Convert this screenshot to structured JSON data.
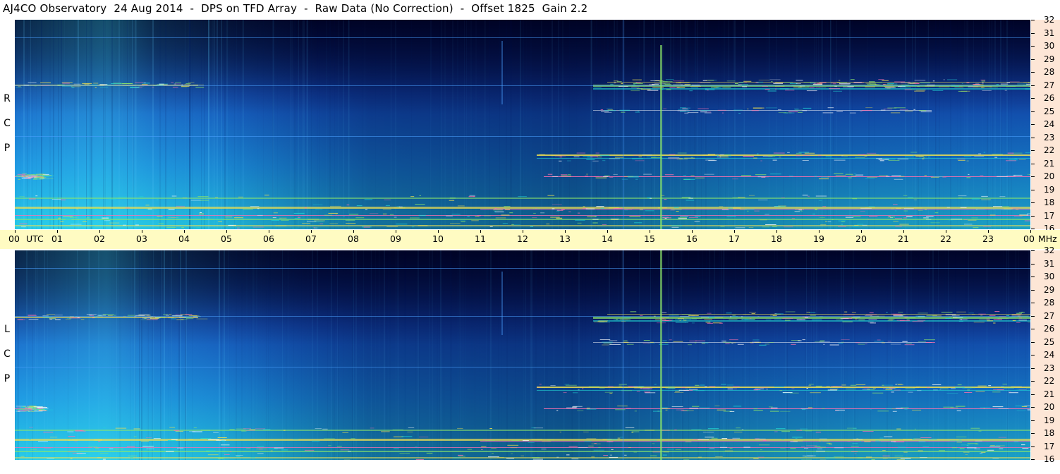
{
  "title": "AJ4CO Observatory  24 Aug 2014  -  DPS on TFD Array  -  Raw Data (No Correction)  -  Offset 1825  Gain 2.2",
  "chart_data": [
    {
      "type": "heatmap",
      "panel": "RCP",
      "polarization_label": [
        "R",
        "C",
        "P"
      ],
      "x_ticks": [
        "00",
        "UTC",
        "01",
        "02",
        "03",
        "04",
        "05",
        "06",
        "07",
        "08",
        "09",
        "10",
        "11",
        "12",
        "13",
        "14",
        "15",
        "16",
        "17",
        "18",
        "19",
        "20",
        "21",
        "22",
        "23",
        "00",
        "MHz"
      ],
      "x_range_hours": [
        0,
        24
      ],
      "y_ticks": [
        32,
        31,
        30,
        29,
        28,
        27,
        26,
        25,
        24,
        23,
        22,
        21,
        20,
        19,
        18,
        17,
        16
      ],
      "y_range_mhz": [
        16,
        32
      ],
      "colormap": [
        "#000022",
        "#00105c",
        "#1e63c8",
        "#1aa8e8",
        "#22d6d6",
        "#8ee86a",
        "#f0e050",
        "#ff70b0"
      ]
    },
    {
      "type": "heatmap",
      "panel": "LCP",
      "polarization_label": [
        "L",
        "C",
        "P"
      ],
      "x_range_hours": [
        0,
        24
      ],
      "y_ticks": [
        32,
        31,
        30,
        29,
        28,
        27,
        26,
        25,
        24,
        23,
        22,
        21,
        20,
        19,
        18,
        17,
        16
      ],
      "y_range_mhz": [
        16,
        32
      ]
    }
  ],
  "time_axis": {
    "hours": [
      "00",
      "01",
      "02",
      "03",
      "04",
      "05",
      "06",
      "07",
      "08",
      "09",
      "10",
      "11",
      "12",
      "13",
      "14",
      "15",
      "16",
      "17",
      "18",
      "19",
      "20",
      "21",
      "22",
      "23",
      "00"
    ],
    "utc_label": "UTC",
    "unit_label": "MHz"
  },
  "polarizations": {
    "top": [
      "R",
      "C",
      "P"
    ],
    "bottom": [
      "L",
      "C",
      "P"
    ]
  },
  "frequency_ticks": [
    "32",
    "31",
    "30",
    "29",
    "28",
    "27",
    "26",
    "25",
    "24",
    "23",
    "22",
    "21",
    "20",
    "19",
    "18",
    "17",
    "16"
  ]
}
